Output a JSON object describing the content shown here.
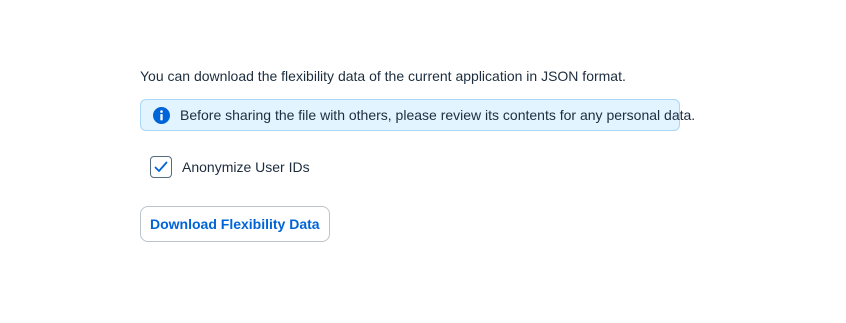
{
  "dialog": {
    "description": "You can download the flexibility data of the current application in JSON format.",
    "info_strip": {
      "icon": "information-icon",
      "text": "Before sharing the file with others, please review its contents for any personal data.",
      "background_color": "#e1f4ff",
      "icon_color": "#0064d9"
    },
    "anonymize_checkbox": {
      "label": "Anonymize User IDs",
      "checked": true,
      "icon": "checkmark-icon"
    },
    "download_button": {
      "label": "Download Flexibility Data",
      "text_color": "#0064d9"
    }
  }
}
